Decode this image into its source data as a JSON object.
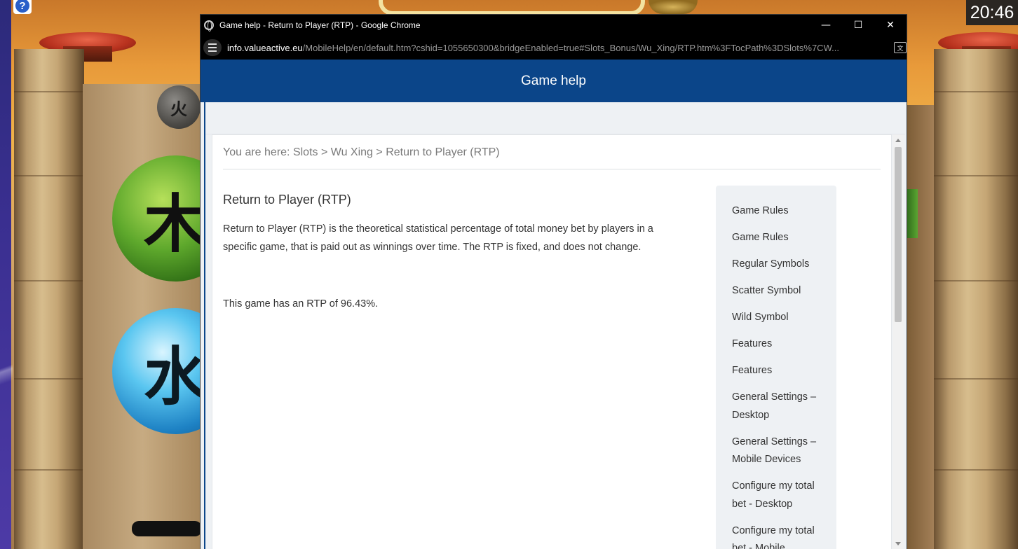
{
  "clock": "20:46",
  "game_icons": {
    "help": "?",
    "fire": "火",
    "wood": "木",
    "water": "水"
  },
  "window": {
    "title": "Game help - Return to Player (RTP) - Google Chrome",
    "controls": {
      "minimize": "—",
      "maximize": "☐",
      "close": "✕"
    }
  },
  "address": {
    "host": "info.valueactive.eu",
    "path": "/MobileHelp/en/default.htm?cshid=1055650300&bridgeEnabled=true#Slots_Bonus/Wu_Xing/RTP.htm%3FTocPath%3DSlots%7CW..."
  },
  "page": {
    "header": "Game help",
    "breadcrumb": {
      "prefix": "You are here:",
      "items": [
        "Slots",
        "Wu Xing",
        "Return to Player (RTP)"
      ],
      "separator": ">"
    },
    "article": {
      "title": "Return to Player (RTP)",
      "paragraph": "Return to Player (RTP) is the theoretical statistical percentage of total money bet by players in a specific game, that is paid out as winnings over time. The RTP is fixed, and does not change.",
      "rtp_text": "This game has an RTP of 96.43%."
    },
    "toc": [
      "Game Rules",
      "Game Rules",
      "Regular Symbols",
      "Scatter Symbol",
      "Wild Symbol",
      "Features",
      "Features",
      "General Settings – Desktop",
      "General Settings – Mobile Devices",
      "Configure my total bet - Desktop",
      "Configure my total bet - Mobile"
    ]
  },
  "colors": {
    "header_bg": "#0b4589",
    "titlebar_bg": "#000000",
    "page_bg": "#eef1f4"
  }
}
